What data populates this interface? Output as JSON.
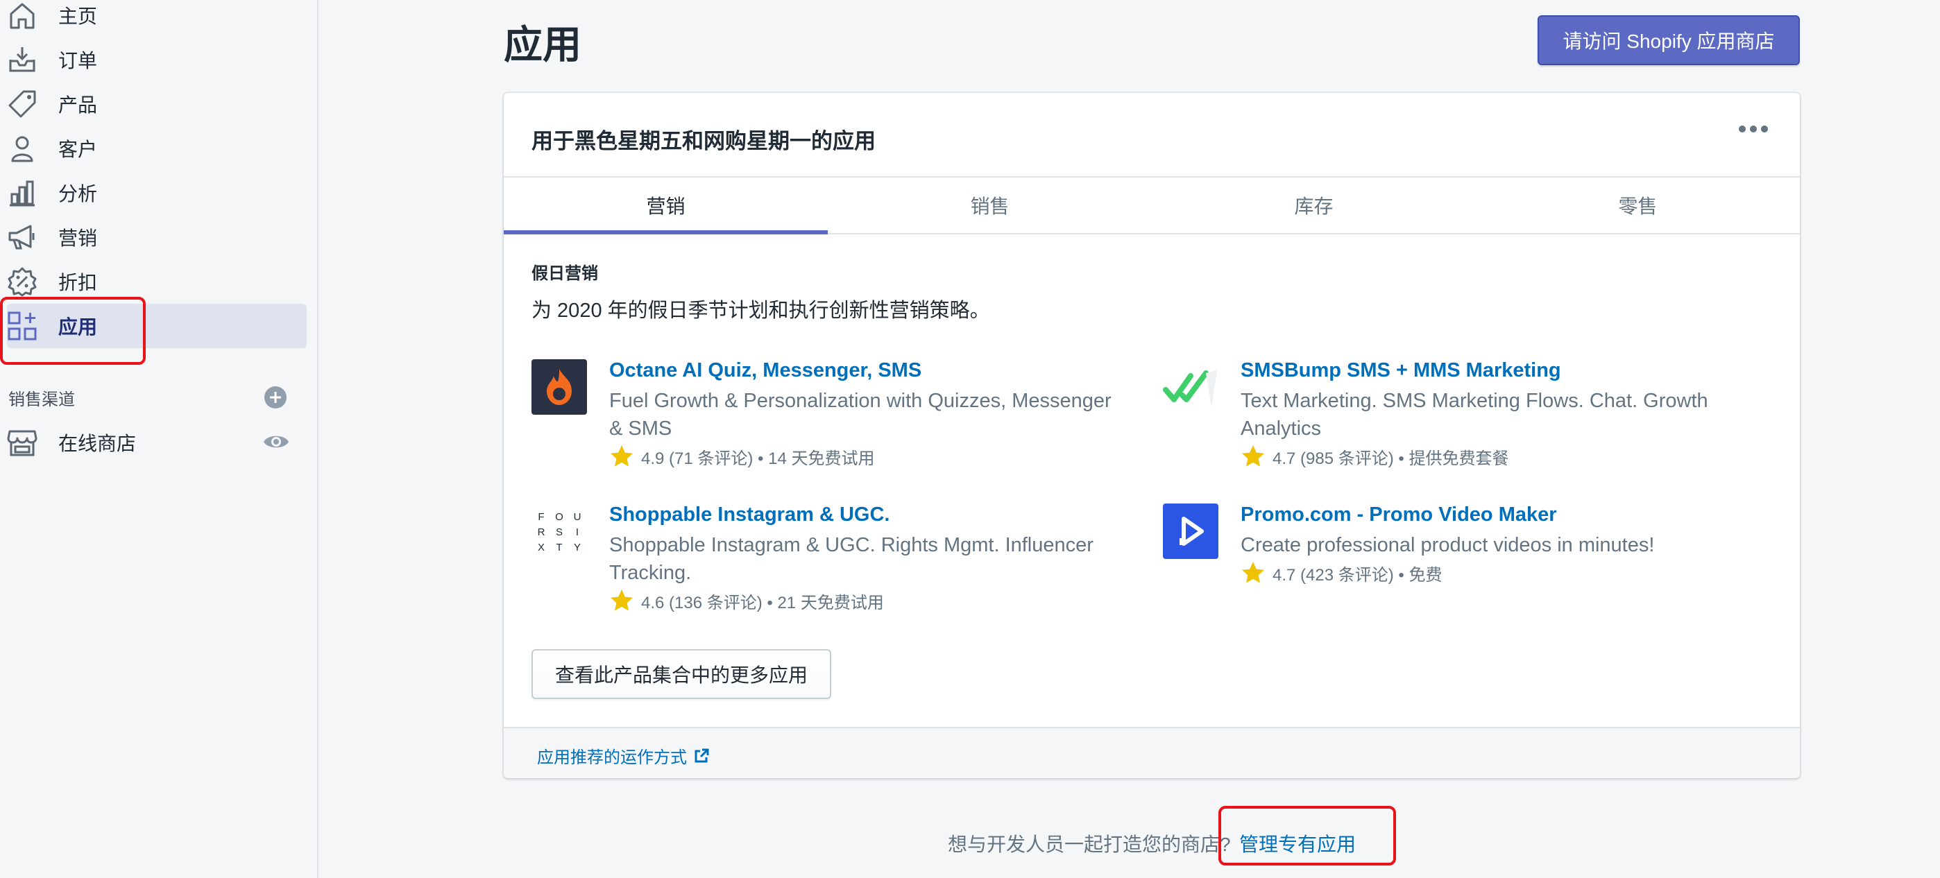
{
  "sidebar": {
    "items": [
      {
        "label": "主页",
        "icon": "home-icon"
      },
      {
        "label": "订单",
        "icon": "orders-icon"
      },
      {
        "label": "产品",
        "icon": "tag-icon"
      },
      {
        "label": "客户",
        "icon": "person-icon"
      },
      {
        "label": "分析",
        "icon": "bar-chart-icon"
      },
      {
        "label": "营销",
        "icon": "megaphone-icon"
      },
      {
        "label": "折扣",
        "icon": "discount-icon"
      },
      {
        "label": "应用",
        "icon": "apps-icon",
        "active": true
      }
    ],
    "sales_channels_title": "销售渠道",
    "online_store_label": "在线商店"
  },
  "header": {
    "title": "应用",
    "shop_button": "请访问 Shopify 应用商店"
  },
  "card": {
    "title": "用于黑色星期五和网购星期一的应用",
    "tabs": [
      {
        "label": "营销",
        "active": true
      },
      {
        "label": "销售"
      },
      {
        "label": "库存"
      },
      {
        "label": "零售"
      }
    ],
    "section_heading": "假日营销",
    "section_desc": "为 2020 年的假日季节计划和执行创新性营销策略。",
    "apps": [
      {
        "name": "Octane AI Quiz, Messenger, SMS",
        "desc": "Fuel Growth & Personalization with Quizzes, Messenger & SMS",
        "rating": "4.9 (71 条评论) • 14 天免费试用"
      },
      {
        "name": "SMSBump SMS + MMS Marketing",
        "desc": "Text Marketing. SMS Marketing Flows. Chat. Growth Analytics",
        "rating": "4.7 (985 条评论) • 提供免费套餐"
      },
      {
        "name": "Shoppable Instagram & UGC.",
        "desc": "Shoppable Instagram & UGC. Rights Mgmt. Influencer Tracking.",
        "rating": "4.6 (136 条评论) • 21 天免费试用",
        "logo_letters": [
          "F",
          "O",
          "U",
          "R",
          "S",
          "I",
          "X",
          "T",
          "Y"
        ]
      },
      {
        "name": "Promo.com - Promo Video Maker",
        "desc": "Create professional product videos in minutes!",
        "rating": "4.7 (423 条评论) • 免费"
      }
    ],
    "more_button": "查看此产品集合中的更多应用",
    "footer_link": "应用推荐的运作方式"
  },
  "bottom": {
    "text": "想与开发人员一起打造您的商店?",
    "link": "管理专有应用"
  },
  "colors": {
    "accent": "#5c6ac4",
    "link": "#006fbb",
    "highlight_box": "#e8131b",
    "star": "#eec200"
  }
}
